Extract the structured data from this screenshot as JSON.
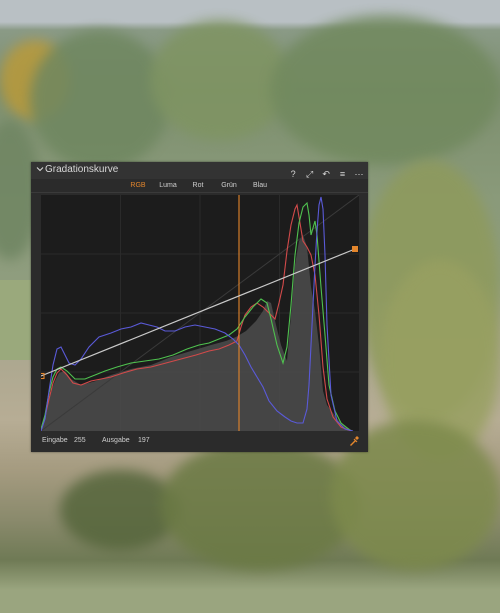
{
  "panel": {
    "title": "Gradationskurve",
    "header_icons": [
      "help-icon",
      "auto-icon",
      "reset-icon",
      "menu-icon",
      "more-icon"
    ],
    "header_glyphs": [
      "?",
      "⤢",
      "↶",
      "≡",
      "⋯"
    ]
  },
  "tabs": [
    {
      "label": "RGB",
      "active": true
    },
    {
      "label": "Luma",
      "active": false
    },
    {
      "label": "Rot",
      "active": false
    },
    {
      "label": "Grün",
      "active": false
    },
    {
      "label": "Blau",
      "active": false
    }
  ],
  "footer": {
    "input_label": "Eingabe",
    "input_value": "255",
    "output_label": "Ausgabe",
    "output_value": "197"
  },
  "colors": {
    "accent": "#e4862c",
    "red": "#d24a4a",
    "green": "#4fc24f",
    "blue": "#5a5ad8",
    "curve": "#c9c9c9"
  }
}
